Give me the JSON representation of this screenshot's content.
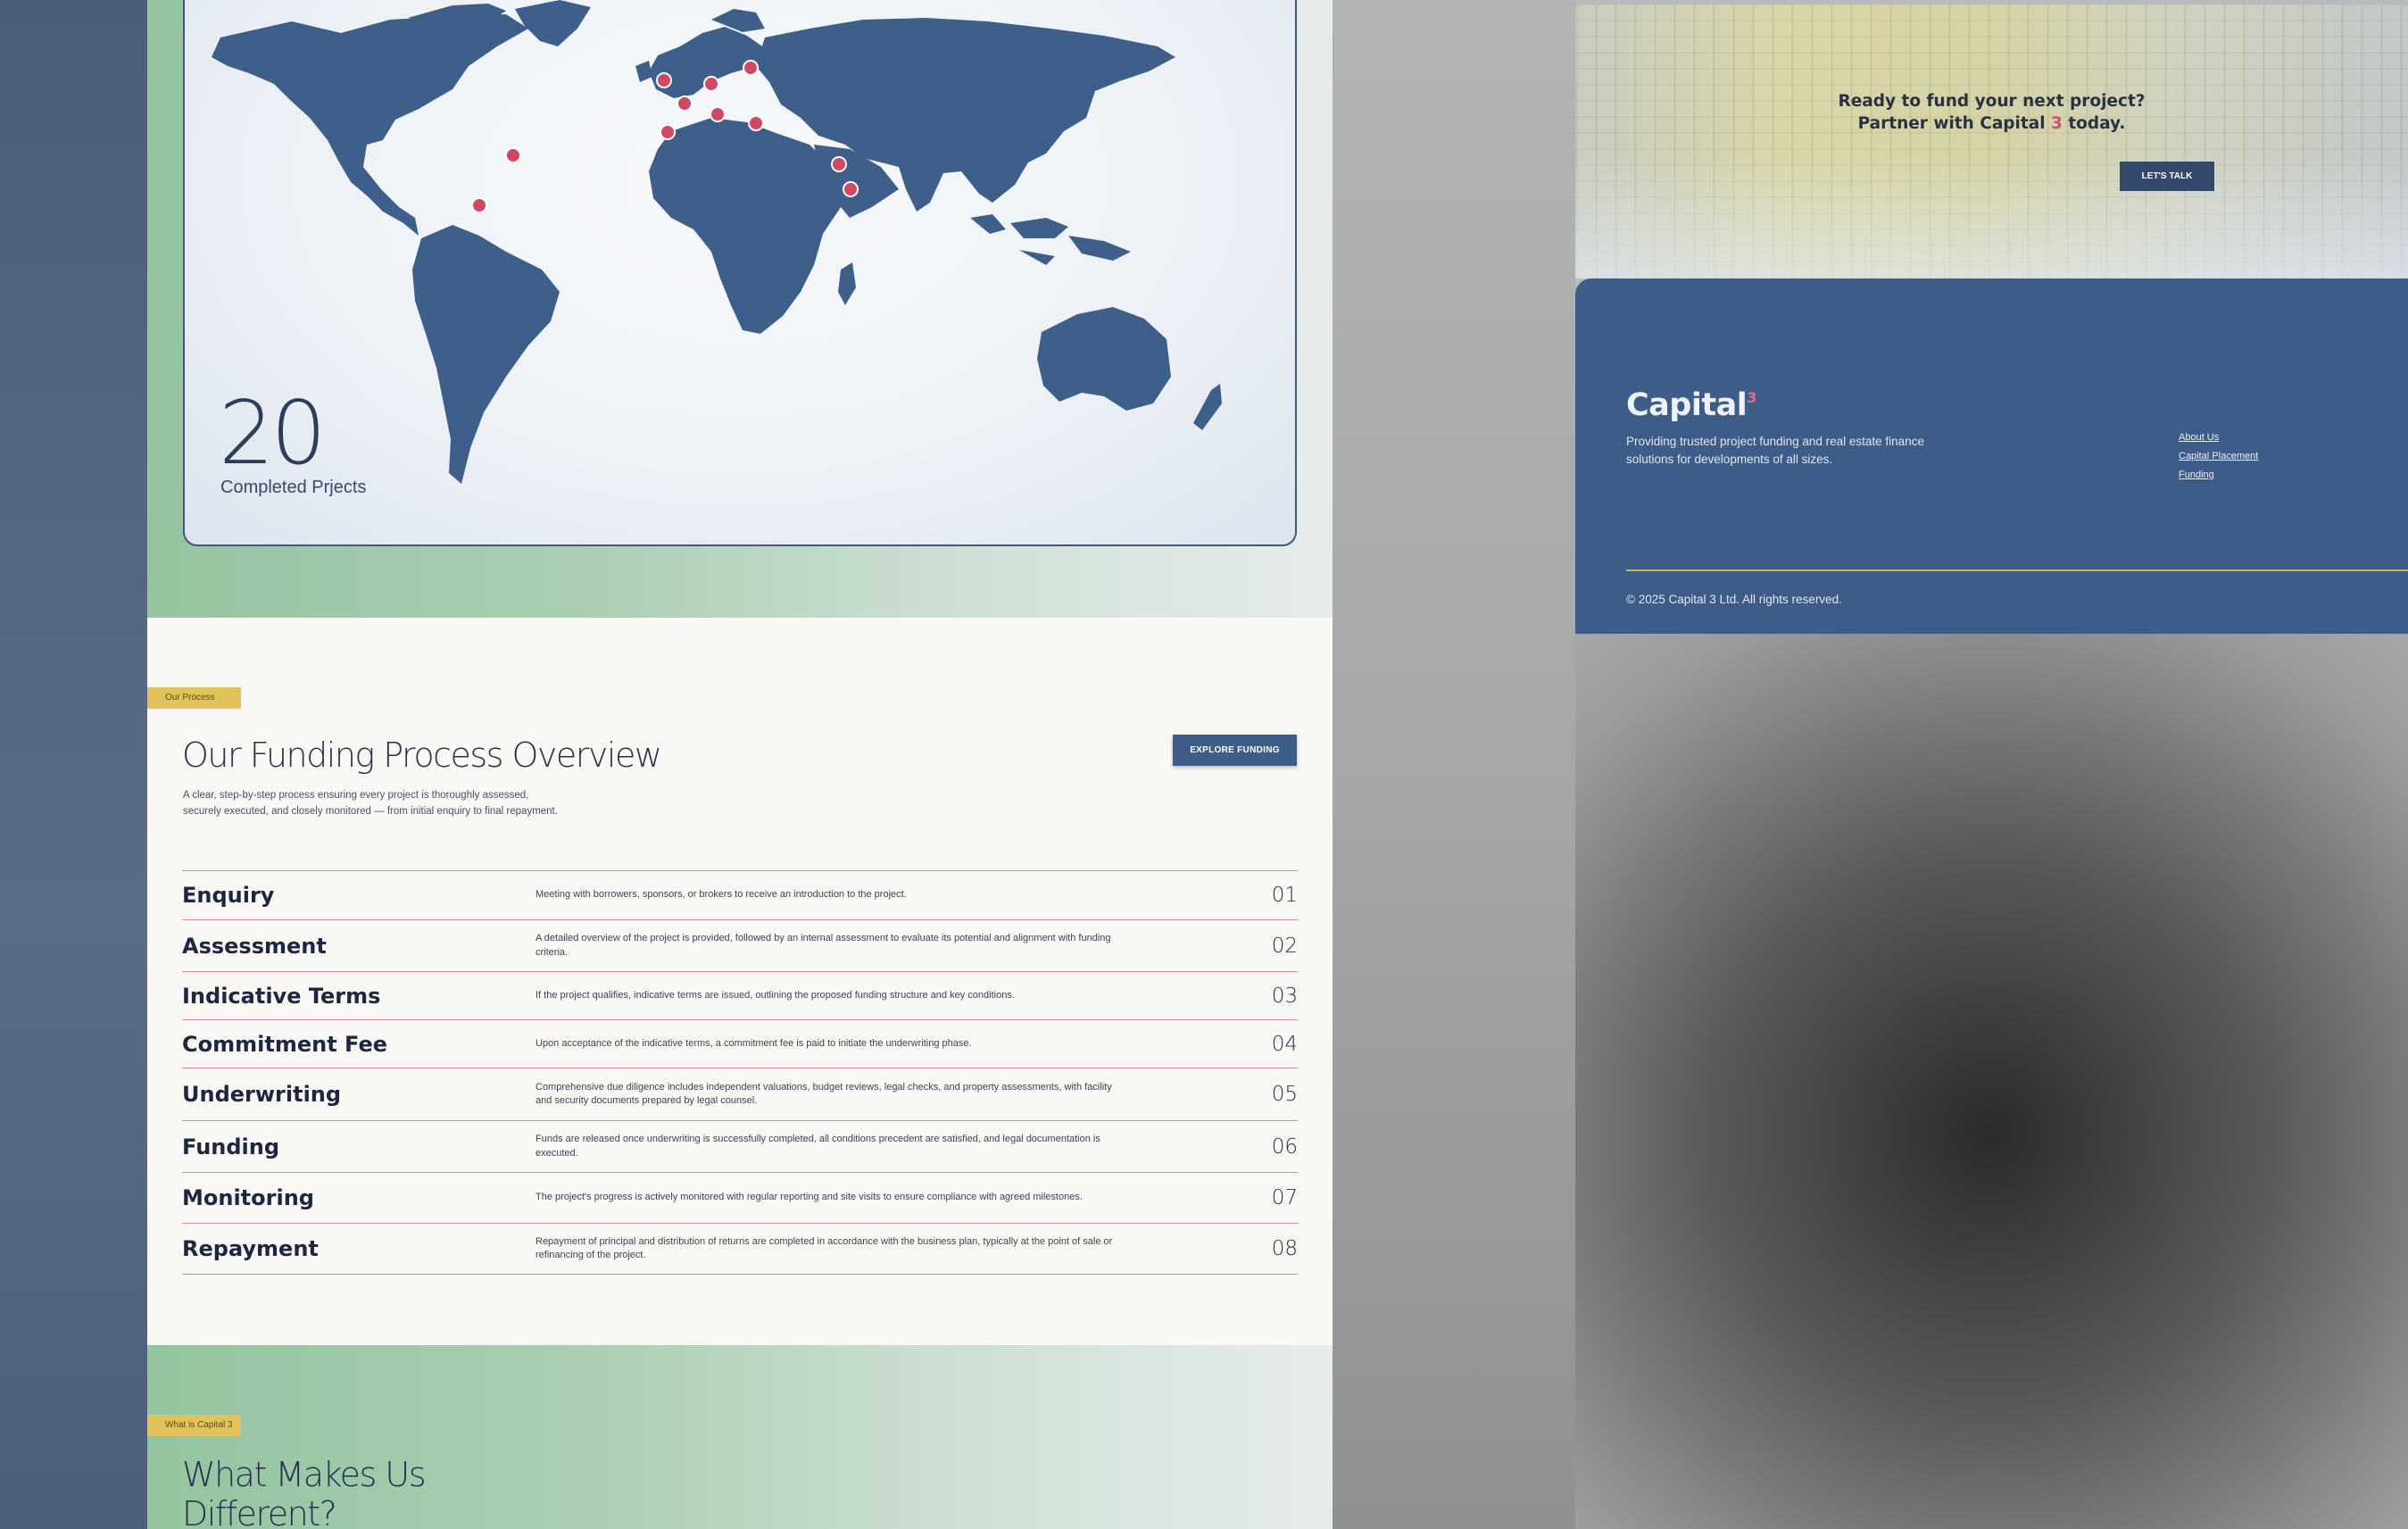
{
  "map": {
    "stat_number": "20",
    "stat_label": "Completed Prjects",
    "colors": {
      "land": "#3e5f8a",
      "marker": "#cf4965"
    }
  },
  "process": {
    "tag": "Our Process",
    "title": "Our Funding Process Overview",
    "description": "A clear, step-by-step process ensuring every project is thoroughly assessed, securely executed, and closely monitored — from initial enquiry to final repayment.",
    "explore_button": "EXPLORE FUNDING",
    "steps": [
      {
        "name": "Enquiry",
        "desc": "Meeting with borrowers, sponsors, or brokers to receive an introduction to the project.",
        "num": "01"
      },
      {
        "name": "Assessment",
        "desc": "A detailed overview of the project is provided, followed by an internal assessment to evaluate its potential and alignment with funding criteria.",
        "num": "02"
      },
      {
        "name": "Indicative Terms",
        "desc": "If the project qualifies, indicative terms are issued, outlining the proposed funding structure and key conditions.",
        "num": "03"
      },
      {
        "name": "Commitment Fee",
        "desc": "Upon acceptance of the indicative terms, a commitment fee is paid to initiate the underwriting phase.",
        "num": "04"
      },
      {
        "name": "Underwriting",
        "desc": "Comprehensive due diligence includes independent valuations, budget reviews, legal checks, and property assessments, with facility and security documents prepared by legal counsel.",
        "num": "05"
      },
      {
        "name": "Funding",
        "desc": "Funds are released once underwriting is successfully completed, all conditions precedent are satisfied, and legal documentation is executed.",
        "num": "06"
      },
      {
        "name": "Monitoring",
        "desc": "The project's progress is actively monitored with regular reporting and site visits to ensure compliance with agreed milestones.",
        "num": "07"
      },
      {
        "name": "Repayment",
        "desc": "Repayment of principal and distribution of returns are completed in accordance with the business plan, typically at the point of sale or refinancing of the project.",
        "num": "08"
      }
    ]
  },
  "difference": {
    "tag": "What is Capital 3",
    "title": "What Makes Us Different?"
  },
  "cta": {
    "line1": "Ready to fund your next project?",
    "line2_prefix": "Partner with Capital ",
    "line2_accent": "3",
    "line2_suffix": " today.",
    "button": "LET'S TALK"
  },
  "footer": {
    "logo_text": "Capital",
    "logo_sup": "3",
    "description": "Providing trusted project funding and real estate finance solutions for developments of all sizes.",
    "links": [
      "About Us",
      "Capital Placement",
      "Funding"
    ],
    "copyright": "© 2025 Capital 3 Ltd. All rights reserved."
  }
}
